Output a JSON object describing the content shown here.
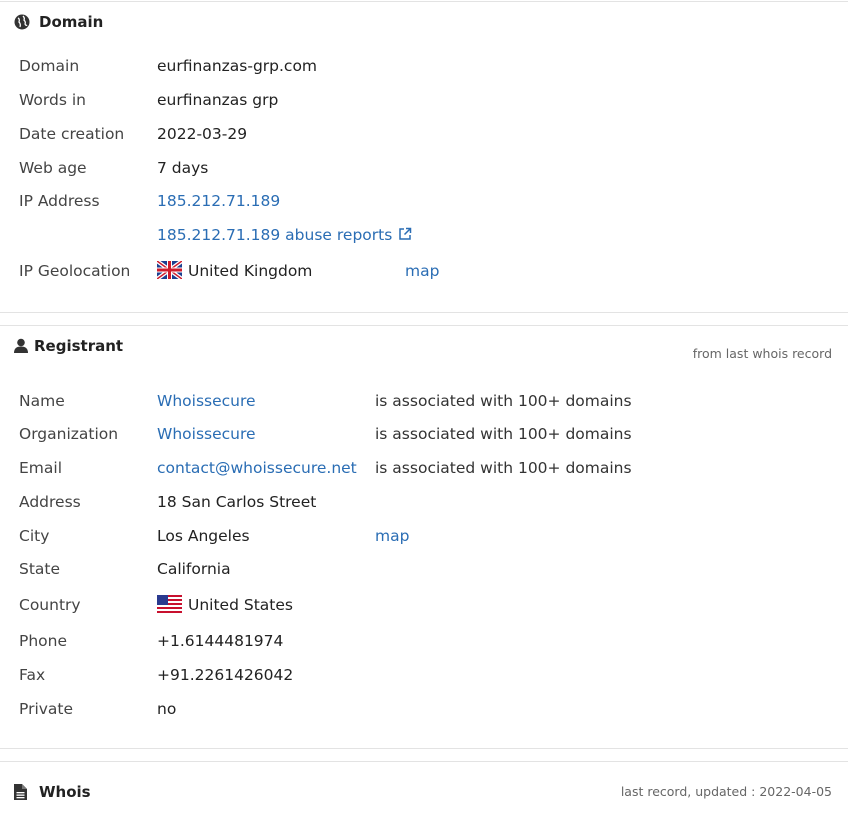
{
  "domain_section": {
    "title": "Domain",
    "icon": "globe-icon",
    "rows": {
      "domain_label": "Domain",
      "domain_value": "eurfinanzas-grp.com",
      "words_label": "Words in",
      "words_value": "eurfinanzas grp",
      "date_label": "Date creation",
      "date_value": "2022-03-29",
      "age_label": "Web age",
      "age_value": "7 days",
      "ip_label": "IP Address",
      "ip_value": "185.212.71.189",
      "abuse_link": "185.212.71.189 abuse reports",
      "geo_label": "IP Geolocation",
      "geo_value": "United Kingdom",
      "geo_map": "map"
    }
  },
  "registrant_section": {
    "title": "Registrant",
    "icon": "user-icon",
    "meta": "from last whois record",
    "rows": {
      "name_label": "Name",
      "name_value": "Whoissecure",
      "name_assoc": "is associated with 100+ domains",
      "org_label": "Organization",
      "org_value": "Whoissecure",
      "org_assoc": "is associated with 100+ domains",
      "email_label": "Email",
      "email_value": "contact@whoissecure.net",
      "email_assoc": "is associated with 100+ domains",
      "address_label": "Address",
      "address_value": "18 San Carlos Street",
      "city_label": "City",
      "city_value": "Los Angeles",
      "city_map": "map",
      "state_label": "State",
      "state_value": "California",
      "country_label": "Country",
      "country_value": "United States",
      "phone_label": "Phone",
      "phone_value": "+1.6144481974",
      "fax_label": "Fax",
      "fax_value": "+91.2261426042",
      "private_label": "Private",
      "private_value": "no"
    }
  },
  "whois_section": {
    "title": "Whois",
    "icon": "document-icon",
    "meta": "last record, updated : 2022-04-05"
  },
  "colors": {
    "link": "#2a6db4",
    "border": "#e3e3e3"
  }
}
